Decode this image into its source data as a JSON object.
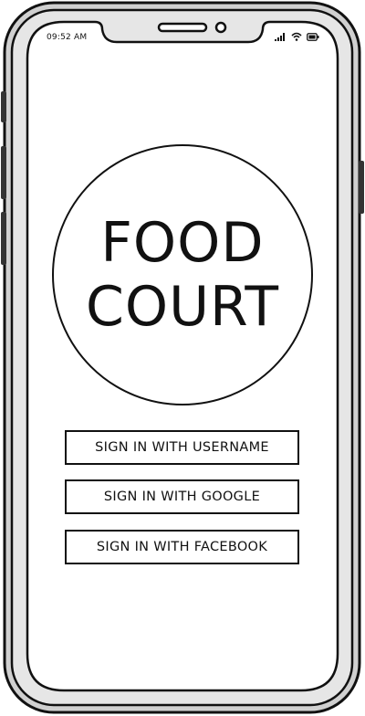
{
  "status_bar": {
    "time": "09:52 AM",
    "icons": [
      "signal-icon",
      "wifi-icon",
      "battery-icon"
    ]
  },
  "logo": {
    "line1": "FOOD",
    "line2": "COURT"
  },
  "buttons": {
    "username": "SIGN IN WITH USERNAME",
    "google": "SIGN IN WITH GOOGLE",
    "facebook": "SIGN IN WITH FACEBOOK"
  },
  "colors": {
    "ink": "#111111",
    "bezel": "#c9c9c9",
    "screen": "#ffffff"
  }
}
